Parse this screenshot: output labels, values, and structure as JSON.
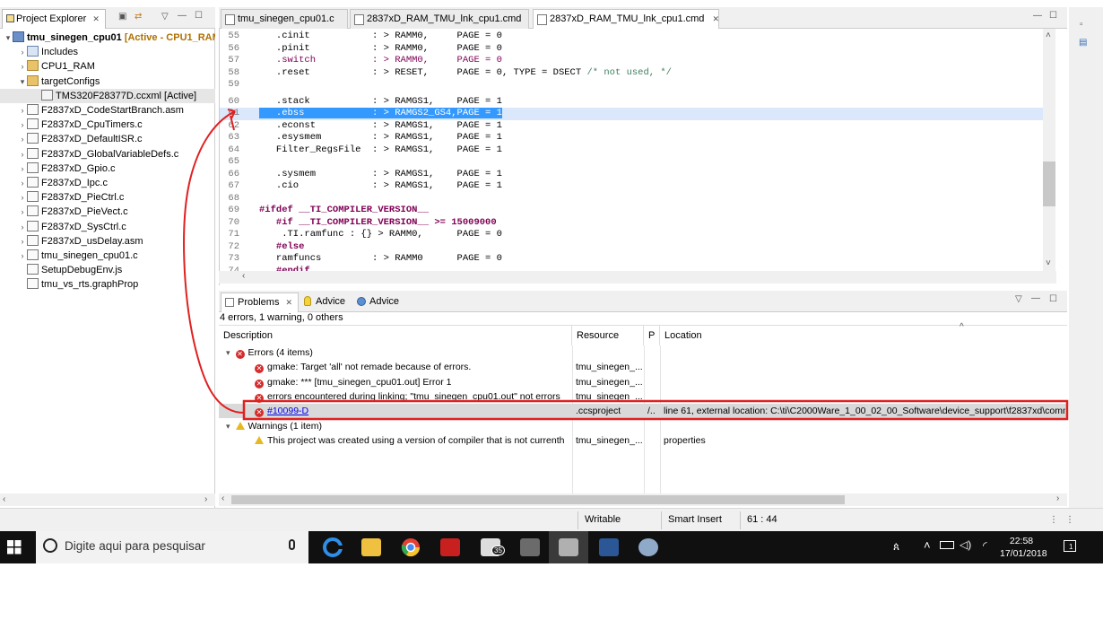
{
  "project_explorer": {
    "tab_label": "Project Explorer",
    "close_glyph": "✕",
    "items": [
      {
        "label": "tmu_sinegen_cpu01",
        "suffix": "[Active - CPU1_RAM",
        "icon": "project-icon",
        "twisty": "▾"
      },
      {
        "label": "Includes",
        "icon": "includes-icon",
        "twisty": "›"
      },
      {
        "label": "CPU1_RAM",
        "icon": "folder-icon",
        "twisty": "›"
      },
      {
        "label": "targetConfigs",
        "icon": "folder-icon",
        "twisty": "▾"
      },
      {
        "label": "TMS320F28377D.ccxml [Active]",
        "icon": "ccxml-file-icon",
        "twisty": ""
      },
      {
        "label": "F2837xD_CodeStartBranch.asm",
        "icon": "asm-file-icon",
        "twisty": "›"
      },
      {
        "label": "F2837xD_CpuTimers.c",
        "icon": "c-file-icon",
        "twisty": "›"
      },
      {
        "label": "F2837xD_DefaultISR.c",
        "icon": "c-file-icon",
        "twisty": "›"
      },
      {
        "label": "F2837xD_GlobalVariableDefs.c",
        "icon": "c-file-icon",
        "twisty": "›"
      },
      {
        "label": "F2837xD_Gpio.c",
        "icon": "c-file-icon",
        "twisty": "›"
      },
      {
        "label": "F2837xD_Ipc.c",
        "icon": "c-file-icon",
        "twisty": "›"
      },
      {
        "label": "F2837xD_PieCtrl.c",
        "icon": "c-file-icon",
        "twisty": "›"
      },
      {
        "label": "F2837xD_PieVect.c",
        "icon": "c-file-icon",
        "twisty": "›"
      },
      {
        "label": "F2837xD_SysCtrl.c",
        "icon": "c-file-icon",
        "twisty": "›"
      },
      {
        "label": "F2837xD_usDelay.asm",
        "icon": "asm-file-icon",
        "twisty": "›"
      },
      {
        "label": "tmu_sinegen_cpu01.c",
        "icon": "c-file-icon",
        "twisty": "›"
      },
      {
        "label": "SetupDebugEnv.js",
        "icon": "js-file-icon",
        "twisty": ""
      },
      {
        "label": "tmu_vs_rts.graphProp",
        "icon": "graphprop-file-icon",
        "twisty": ""
      }
    ]
  },
  "editor": {
    "tabs": [
      {
        "label": "tmu_sinegen_cpu01.c",
        "active": false
      },
      {
        "label": "2837xD_RAM_TMU_lnk_cpu1.cmd",
        "active": false
      },
      {
        "label": "2837xD_RAM_TMU_lnk_cpu1.cmd",
        "active": true
      }
    ],
    "tab_close_glyph": "✕",
    "lines": [
      {
        "n": "55",
        "text": "   .cinit           : > RAMM0,     PAGE = 0"
      },
      {
        "n": "56",
        "text": "   .pinit           : > RAMM0,     PAGE = 0"
      },
      {
        "n": "57",
        "text": "   .switch          : > RAMM0,     PAGE = 0"
      },
      {
        "n": "58",
        "text": "   .reset           : > RESET,     PAGE = 0, TYPE = DSECT "
      },
      {
        "n": "59",
        "text": ""
      },
      {
        "n": "60",
        "text": "   .stack           : > RAMGS1,    PAGE = 1"
      },
      {
        "n": "61",
        "text": "   .ebss            : > RAMGS2_GS4,PAGE = 1"
      },
      {
        "n": "62",
        "text": "   .econst          : > RAMGS1,    PAGE = 1"
      },
      {
        "n": "63",
        "text": "   .esysmem         : > RAMGS1,    PAGE = 1"
      },
      {
        "n": "64",
        "text": "   Filter_RegsFile  : > RAMGS1,    PAGE = 1"
      },
      {
        "n": "65",
        "text": ""
      },
      {
        "n": "66",
        "text": "   .sysmem          : > RAMGS1,    PAGE = 1"
      },
      {
        "n": "67",
        "text": "   .cio             : > RAMGS1,    PAGE = 1"
      },
      {
        "n": "68",
        "text": ""
      },
      {
        "n": "69",
        "text": "#ifdef __TI_COMPILER_VERSION__"
      },
      {
        "n": "70",
        "text": "   #if __TI_COMPILER_VERSION__ >= 15009000"
      },
      {
        "n": "71",
        "text": "    .TI.ramfunc : {} > RAMM0,      PAGE = 0"
      },
      {
        "n": "72",
        "text": "   #else"
      },
      {
        "n": "73",
        "text": "   ramfuncs         : > RAMM0      PAGE = 0"
      },
      {
        "n": "74",
        "text": "   #endif"
      }
    ],
    "line58_comment": "/* not used, */",
    "selected_line_index": 6
  },
  "problems": {
    "tabs": [
      {
        "label": "Problems",
        "icon": "problems-icon"
      },
      {
        "label": "Advice",
        "icon": "lightbulb-icon"
      },
      {
        "label": "Advice",
        "icon": "globe-icon"
      }
    ],
    "summary": "4 errors, 1 warning, 0 others",
    "columns": [
      "Description",
      "Resource",
      "P",
      "Location"
    ],
    "sort_glyph": "^",
    "groups": [
      {
        "label": "Errors (4 items)",
        "kind": "error",
        "rows": [
          {
            "description": "gmake: Target 'all' not remade because of errors.",
            "resource": "tmu_sinegen_...",
            "path": "",
            "location": ""
          },
          {
            "description": "gmake: *** [tmu_sinegen_cpu01.out] Error 1",
            "resource": "tmu_sinegen_...",
            "path": "",
            "location": ""
          },
          {
            "description": "errors encountered during linking; \"tmu_sinegen_cpu01.out\" not errors",
            "resource": "tmu_sinegen_...",
            "path": "",
            "location": ""
          },
          {
            "description": "#10099-D",
            "resource": ".ccsproject",
            "path": "/..",
            "location": "line 61, external location: C:\\ti\\C2000Ware_1_00_02_00_Software\\device_support\\f2837xd\\comn"
          }
        ]
      },
      {
        "label": "Warnings (1 item)",
        "kind": "warning",
        "rows": [
          {
            "description": "This project was created using a version of compiler that is not currenth",
            "resource": "tmu_sinegen_...",
            "path": "",
            "location": "properties"
          }
        ]
      }
    ]
  },
  "status_bar": {
    "mode": "Writable",
    "insert": "Smart Insert",
    "position": "61 : 44"
  },
  "taskbar": {
    "search_placeholder": "Digite aqui para pesquisar",
    "time": "22:58",
    "date": "17/01/2018",
    "mail_badge": "35",
    "notification_count": "1"
  },
  "colors": {
    "selection": "#3399ff",
    "annotation_red": "#e02020",
    "error_red": "#d62b2b",
    "warning_yellow": "#e8b820"
  }
}
